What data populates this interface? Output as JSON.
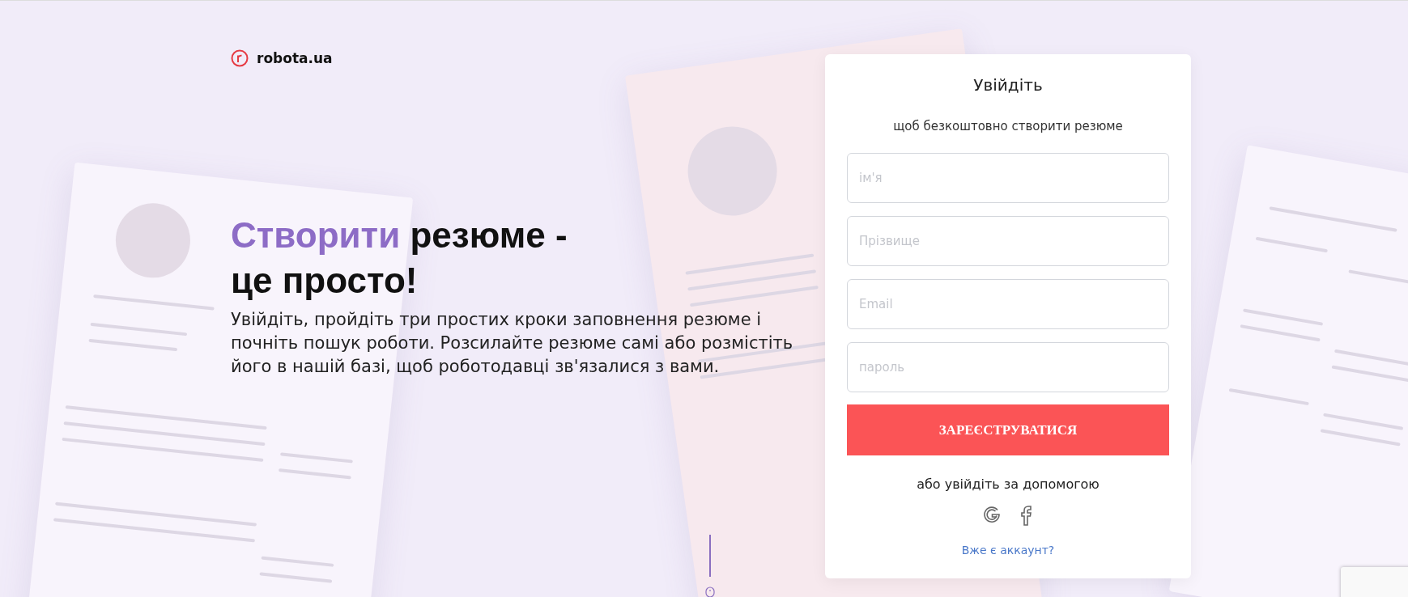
{
  "logo": {
    "text": "robota.ua"
  },
  "hero": {
    "headline_accent": "Створити",
    "headline_rest": "резюме - це просто!",
    "description": "Увійдіть, пройдіть три простих кроки заповнення резюме і почніть пошук роботи. Розсилайте резюме самі або розмістіть його в нашій базі, щоб роботодавці зв'язалися з вами."
  },
  "form": {
    "title": "Увійдіть",
    "subtitle": "щоб безкоштовно створити резюме",
    "fields": [
      {
        "placeholder": "ім'я"
      },
      {
        "placeholder": "Прізвище"
      },
      {
        "placeholder": "Email"
      },
      {
        "placeholder": "пароль"
      }
    ],
    "submit": "ЗАРЕЄСТРУВАТИСЯ",
    "social_label": "або увійдіть за допомогою",
    "social": [
      {
        "kind": "google"
      },
      {
        "kind": "facebook"
      }
    ],
    "login_link": "Вже є аккаунт?"
  }
}
